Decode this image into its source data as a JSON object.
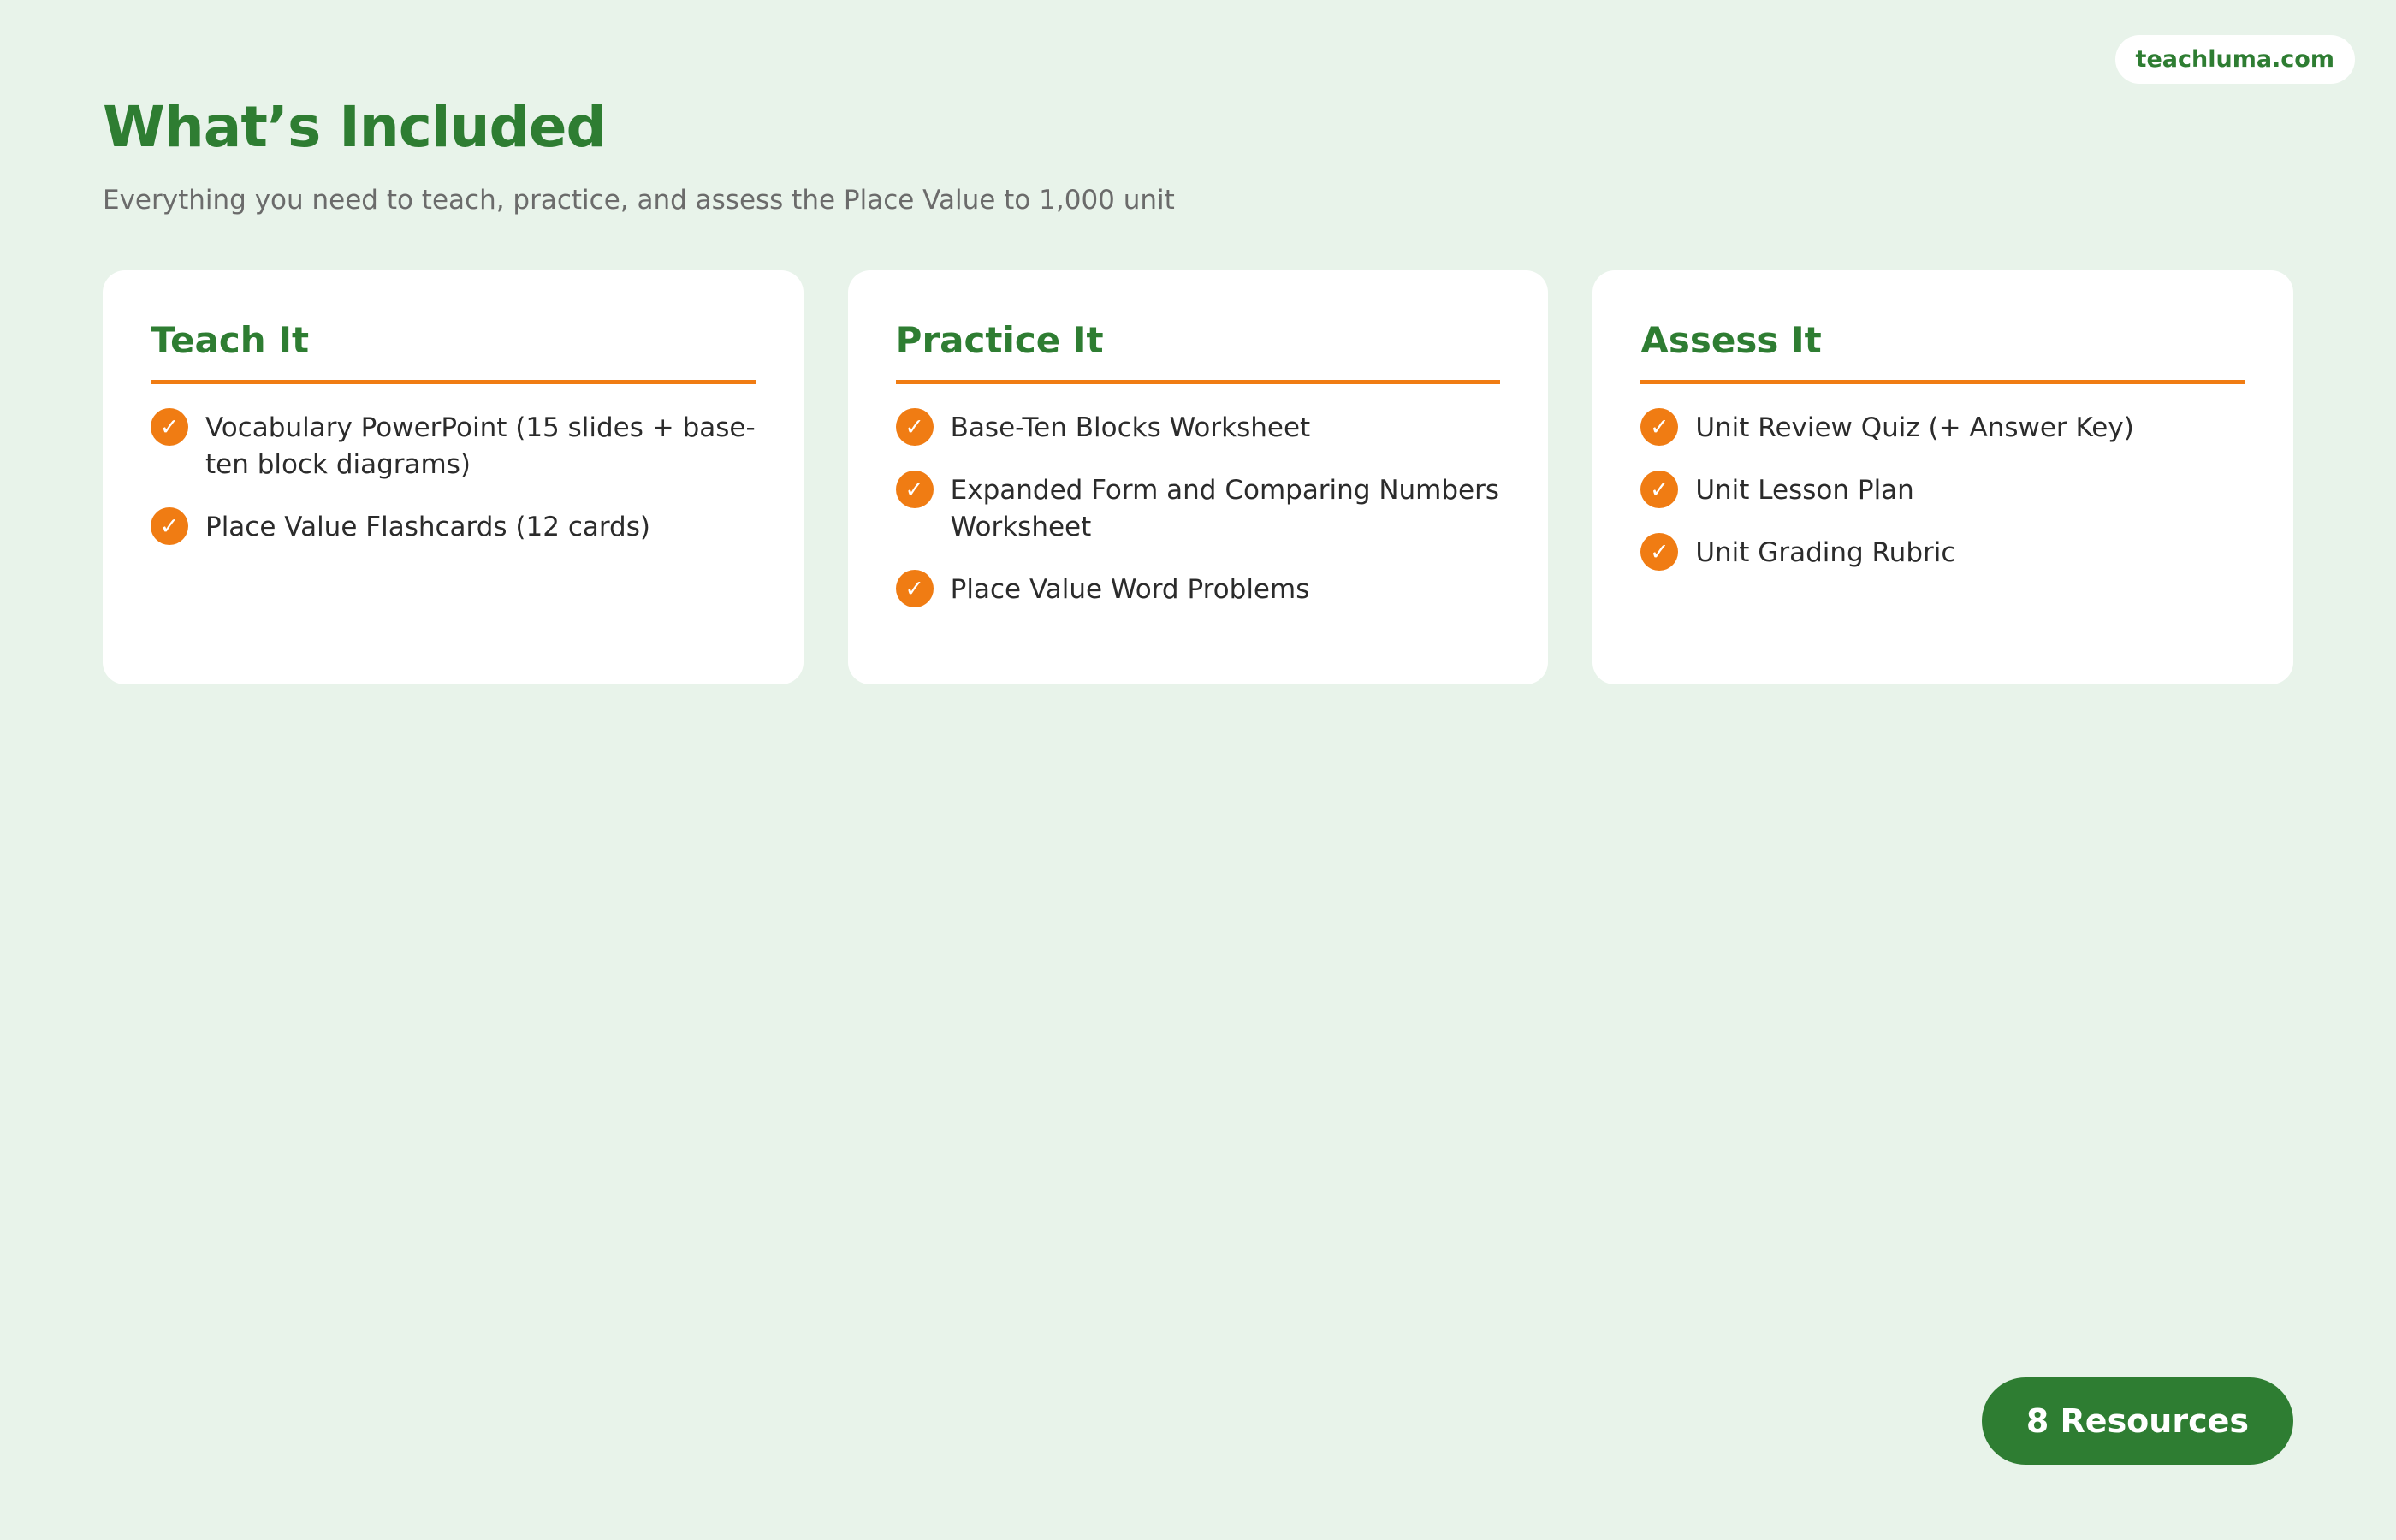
{
  "site": {
    "domain": "teachluma.com"
  },
  "header": {
    "title": "What’s Included",
    "subtitle": "Everything you need to teach, practice, and assess the Place Value to 1,000 unit"
  },
  "cards": [
    {
      "title": "Teach It",
      "items": [
        "Vocabulary PowerPoint (15 slides + base-ten block diagrams)",
        "Place Value Flashcards (12 cards)"
      ]
    },
    {
      "title": "Practice It",
      "items": [
        "Base-Ten Blocks Worksheet",
        "Expanded Form and Comparing Numbers Worksheet",
        "Place Value Word Problems"
      ]
    },
    {
      "title": "Assess It",
      "items": [
        "Unit Review Quiz (+ Answer Key)",
        "Unit Lesson Plan",
        "Unit Grading Rubric"
      ]
    }
  ],
  "footer": {
    "resources_label": "8 Resources"
  },
  "icons": {
    "check": "check-circle-icon",
    "check_glyph": "✓"
  },
  "colors": {
    "brand_green": "#2e7d32",
    "accent_orange": "#f07c13",
    "background": "#e8f3ea"
  }
}
